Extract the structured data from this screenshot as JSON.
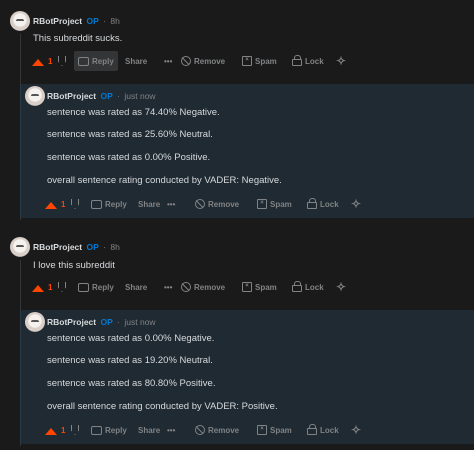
{
  "threads": [
    {
      "post": {
        "user": "RBotProject",
        "op": "OP",
        "time": "8h",
        "text": "This subreddit sucks.",
        "votes": "1"
      },
      "reply": {
        "user": "RBotProject",
        "op": "OP",
        "time": "just now",
        "lines": [
          "sentence was rated as 74.40% Negative.",
          "sentence was rated as 25.60% Neutral.",
          "sentence was rated as 0.00% Positive.",
          "overall sentence rating conducted by VADER: Negative."
        ],
        "votes": "1"
      }
    },
    {
      "post": {
        "user": "RBotProject",
        "op": "OP",
        "time": "8h",
        "text": "I love this subreddit",
        "votes": "1"
      },
      "reply": {
        "user": "RBotProject",
        "op": "OP",
        "time": "just now",
        "lines": [
          "sentence was rated as 0.00% Negative.",
          "sentence was rated as 19.20% Neutral.",
          "sentence was rated as 80.80% Positive.",
          "overall sentence rating conducted by VADER: Positive."
        ],
        "votes": "1"
      }
    }
  ],
  "actions": {
    "reply": "Reply",
    "share": "Share",
    "more": "•••",
    "remove": "Remove",
    "spam": "Spam",
    "lock": "Lock"
  },
  "icons": {
    "upvote": "upvote-arrow-icon",
    "downvote": "downvote-arrow-icon",
    "reply": "speech-bubble-icon",
    "remove": "no-entry-icon",
    "spam": "spam-box-icon",
    "lock": "padlock-icon",
    "mod": "mod-shield-icon"
  },
  "colors": {
    "background": "#1a1a1b",
    "reply_background": "#1f2a33",
    "upvote": "#ff4500",
    "op": "#0079d3",
    "muted": "#818384",
    "text": "#d7dadc"
  }
}
